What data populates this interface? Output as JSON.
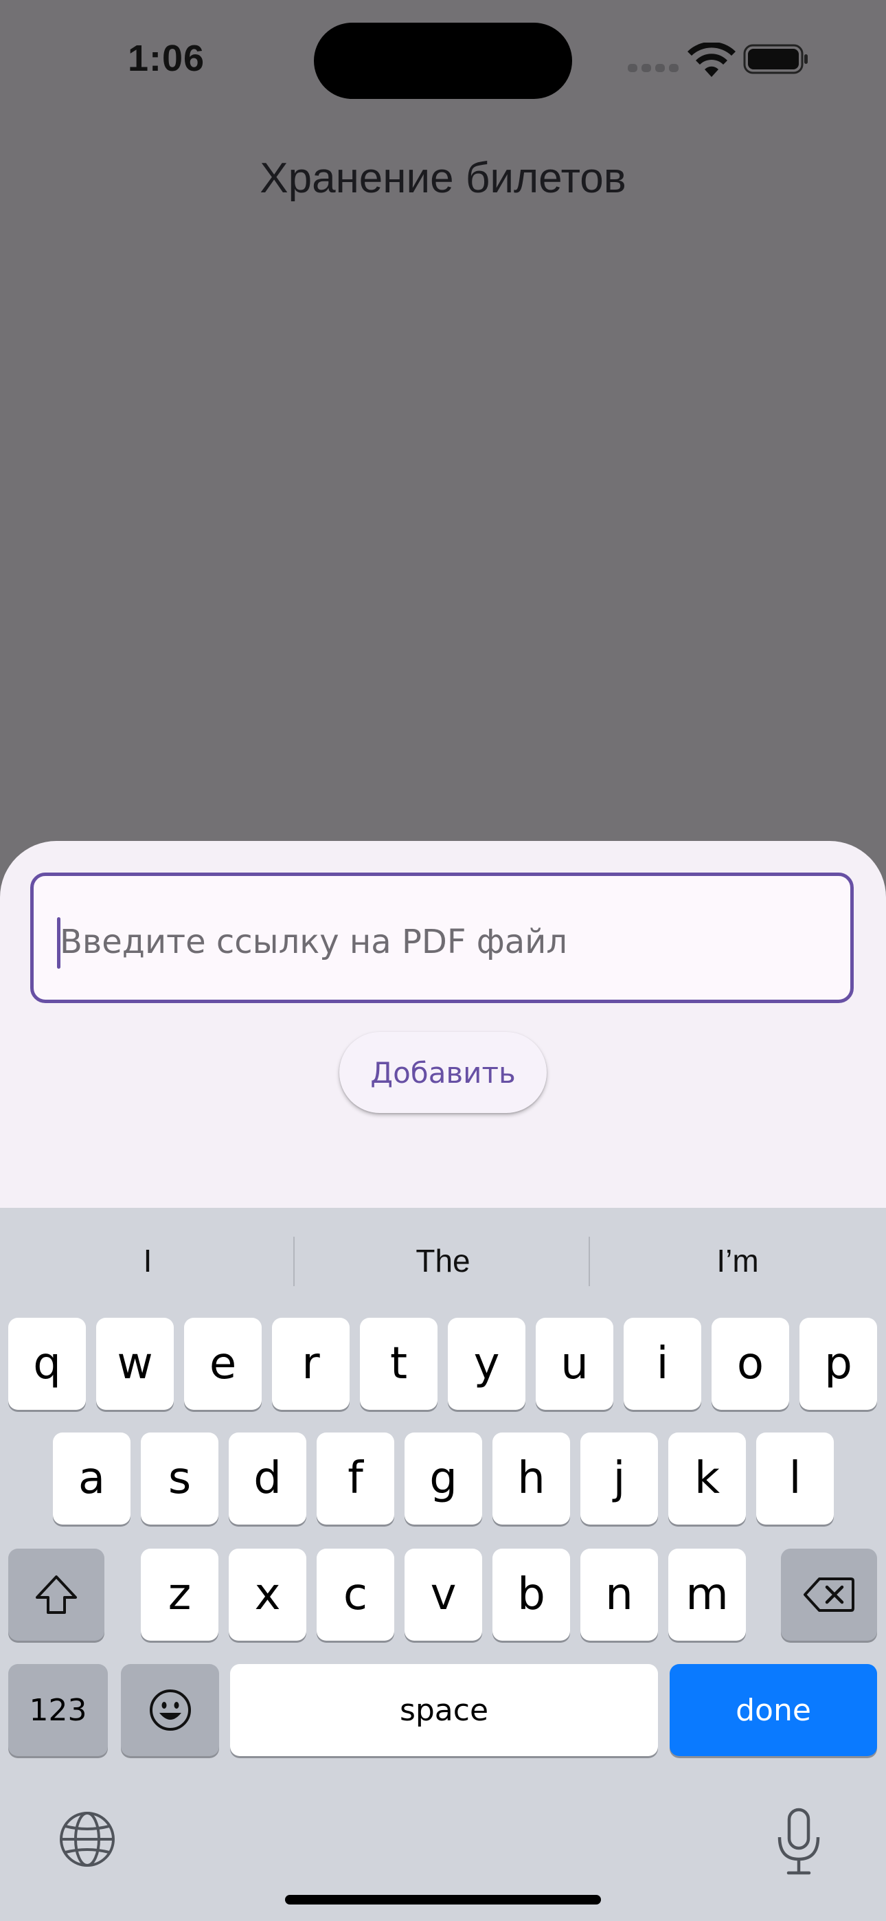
{
  "status": {
    "time": "1:06"
  },
  "app": {
    "title": "Хранение билетов"
  },
  "sheet": {
    "input_placeholder": "Введите ссылку на PDF файл",
    "input_value": "",
    "add_button_label": "Добавить"
  },
  "keyboard": {
    "suggestions": [
      "I",
      "The",
      "I’m"
    ],
    "row1": [
      "q",
      "w",
      "e",
      "r",
      "t",
      "y",
      "u",
      "i",
      "o",
      "p"
    ],
    "row2": [
      "a",
      "s",
      "d",
      "f",
      "g",
      "h",
      "j",
      "k",
      "l"
    ],
    "row3": [
      "z",
      "x",
      "c",
      "v",
      "b",
      "n",
      "m"
    ],
    "numbers_label": "123",
    "space_label": "space",
    "done_label": "done",
    "done_color": "#0a7aff"
  },
  "colors": {
    "accent": "#6750a4",
    "scrim": "#737174",
    "sheet": "#f5f0f7"
  }
}
